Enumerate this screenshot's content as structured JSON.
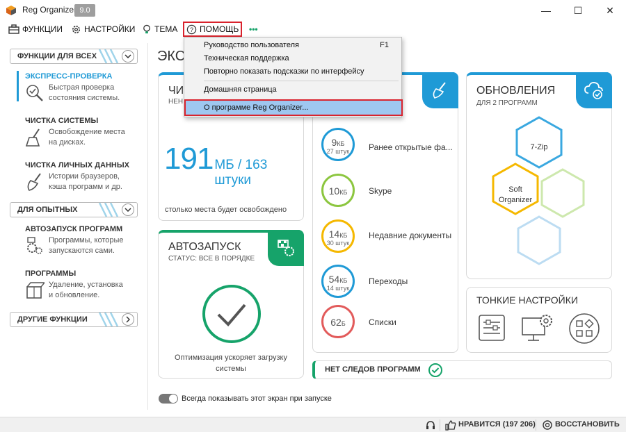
{
  "window": {
    "title": "Reg Organizer",
    "version": "9.0",
    "controls": {
      "minimize": "—",
      "maximize": "☐",
      "close": "✕"
    }
  },
  "menu": {
    "functions": "ФУНКЦИИ",
    "settings": "НАСТРОЙКИ",
    "theme": "ТЕМА",
    "help": "ПОМОЩЬ",
    "more": "•••"
  },
  "help_menu": {
    "items": [
      {
        "label": "Руководство пользователя",
        "shortcut": "F1"
      },
      {
        "label": "Техническая поддержка",
        "shortcut": ""
      },
      {
        "label": "Повторно показать подсказки по интерфейсу",
        "shortcut": ""
      },
      {
        "label": "Домашняя страница",
        "shortcut": ""
      },
      {
        "label": "О программе Reg Organizer...",
        "shortcut": ""
      }
    ]
  },
  "sidebar": {
    "group_all": "ФУНКЦИИ ДЛЯ ВСЕХ",
    "group_advanced": "ДЛЯ ОПЫТНЫХ",
    "group_other": "ДРУГИЕ ФУНКЦИИ",
    "items": [
      {
        "title": "ЭКСПРЕСС-ПРОВЕРКА",
        "desc1": "Быстрая проверка",
        "desc2": "состояния системы.",
        "icon": "magnifier-check-icon"
      },
      {
        "title": "ЧИСТКА СИСТЕМЫ",
        "desc1": "Освобождение места",
        "desc2": "на дисках.",
        "icon": "broom-icon"
      },
      {
        "title": "ЧИСТКА ЛИЧНЫХ ДАННЫХ",
        "desc1": "Истории браузеров,",
        "desc2": "кэша программ и др.",
        "icon": "brush-icon"
      },
      {
        "title": "АВТОЗАПУСК ПРОГРАММ",
        "desc1": "Программы, которые",
        "desc2": "запускаются сами.",
        "icon": "gears-flag-icon"
      },
      {
        "title": "ПРОГРАММЫ",
        "desc1": "Удаление, установка",
        "desc2": "и обновление.",
        "icon": "box-icon"
      }
    ]
  },
  "main": {
    "title": "ЭКС",
    "cleanup": {
      "title": "ЧИ",
      "subtitle": "НЕН",
      "big_value": "191",
      "unit": "МБ / 163 штуки",
      "note": "столько места будет освобождено"
    },
    "autorun": {
      "title": "АВТОЗАПУСК",
      "status": "СТАТУС: ВСЕ В ПОРЯДКЕ",
      "note1": "Оптимизация ускоряет загрузку",
      "note2": "системы"
    },
    "privacy": {
      "rows": [
        {
          "value": "9",
          "unit": "КБ",
          "count": "27 штук",
          "label": "Ранее открытые фа...",
          "color": "#1f9ad6"
        },
        {
          "value": "10",
          "unit": "КБ",
          "count": "",
          "label": "Skype",
          "color": "#8cc63f"
        },
        {
          "value": "14",
          "unit": "КБ",
          "count": "30 штук",
          "label": "Недавние документы",
          "color": "#f5b800"
        },
        {
          "value": "54",
          "unit": "КБ",
          "count": "14 штук",
          "label": "Переходы",
          "color": "#1f9ad6"
        },
        {
          "value": "62",
          "unit": "Б",
          "count": "",
          "label": "Списки",
          "color": "#e25b5b"
        }
      ]
    },
    "updates": {
      "title": "ОБНОВЛЕНИЯ",
      "subtitle": "ДЛЯ 2 ПРОГРАММ",
      "hex1": "7-Zip",
      "hex2a": "Soft",
      "hex2b": "Organizer"
    },
    "tweaks": {
      "title": "ТОНКИЕ НАСТРОЙКИ"
    },
    "no_traces": "НЕТ СЛЕДОВ ПРОГРАММ",
    "show_toggle": "Всегда показывать этот экран при запуске"
  },
  "status": {
    "likes": "НРАВИТСЯ (197 206)",
    "restore": "ВОССТАНОВИТЬ"
  },
  "colors": {
    "blue": "#1f9ad6",
    "green": "#16a36a",
    "red": "#d9232d"
  }
}
